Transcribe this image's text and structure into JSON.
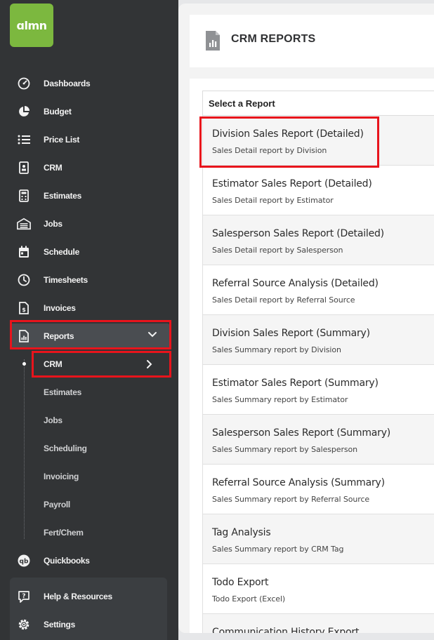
{
  "brand": {
    "logo_text": "ɑlmn",
    "accent": "#7cb83f"
  },
  "sidebar": {
    "items": [
      {
        "label": "Dashboards",
        "icon": "gauge-icon"
      },
      {
        "label": "Budget",
        "icon": "pie-chart-icon"
      },
      {
        "label": "Price List",
        "icon": "list-icon"
      },
      {
        "label": "CRM",
        "icon": "contact-card-icon"
      },
      {
        "label": "Estimates",
        "icon": "calculator-icon"
      },
      {
        "label": "Jobs",
        "icon": "garage-icon"
      },
      {
        "label": "Schedule",
        "icon": "calendar-icon"
      },
      {
        "label": "Timesheets",
        "icon": "clock-icon"
      },
      {
        "label": "Invoices",
        "icon": "invoice-icon"
      },
      {
        "label": "Reports",
        "icon": "report-icon"
      }
    ],
    "reports_submenu": [
      {
        "label": "CRM"
      },
      {
        "label": "Estimates"
      },
      {
        "label": "Jobs"
      },
      {
        "label": "Scheduling"
      },
      {
        "label": "Invoicing"
      },
      {
        "label": "Payroll"
      },
      {
        "label": "Fert/Chem"
      }
    ],
    "quickbooks": {
      "label": "Quickbooks",
      "icon": "quickbooks-icon"
    },
    "bottom": [
      {
        "label": "Help & Resources",
        "icon": "help-icon"
      },
      {
        "label": "Settings",
        "icon": "gear-icon"
      }
    ],
    "highlight_color": "#e8141c"
  },
  "page": {
    "title": "CRM REPORTS",
    "list_header": "Select a Report",
    "reports": [
      {
        "title": "Division Sales Report (Detailed)",
        "subtitle": "Sales Detail report by Division"
      },
      {
        "title": "Estimator Sales Report (Detailed)",
        "subtitle": "Sales Detail report by Estimator"
      },
      {
        "title": "Salesperson Sales Report (Detailed)",
        "subtitle": "Sales Detail report by Salesperson"
      },
      {
        "title": "Referral Source Analysis (Detailed)",
        "subtitle": "Sales Detail report by Referral Source"
      },
      {
        "title": "Division Sales Report (Summary)",
        "subtitle": "Sales Summary report by Division"
      },
      {
        "title": "Estimator Sales Report (Summary)",
        "subtitle": "Sales Summary report by Estimator"
      },
      {
        "title": "Salesperson Sales Report (Summary)",
        "subtitle": "Sales Summary report by Salesperson"
      },
      {
        "title": "Referral Source Analysis (Summary)",
        "subtitle": "Sales Summary report by Referral Source"
      },
      {
        "title": "Tag Analysis",
        "subtitle": "Sales Summary report by CRM Tag"
      },
      {
        "title": "Todo Export",
        "subtitle": "Todo Export (Excel)"
      },
      {
        "title": "Communication History Export",
        "subtitle": ""
      }
    ]
  }
}
